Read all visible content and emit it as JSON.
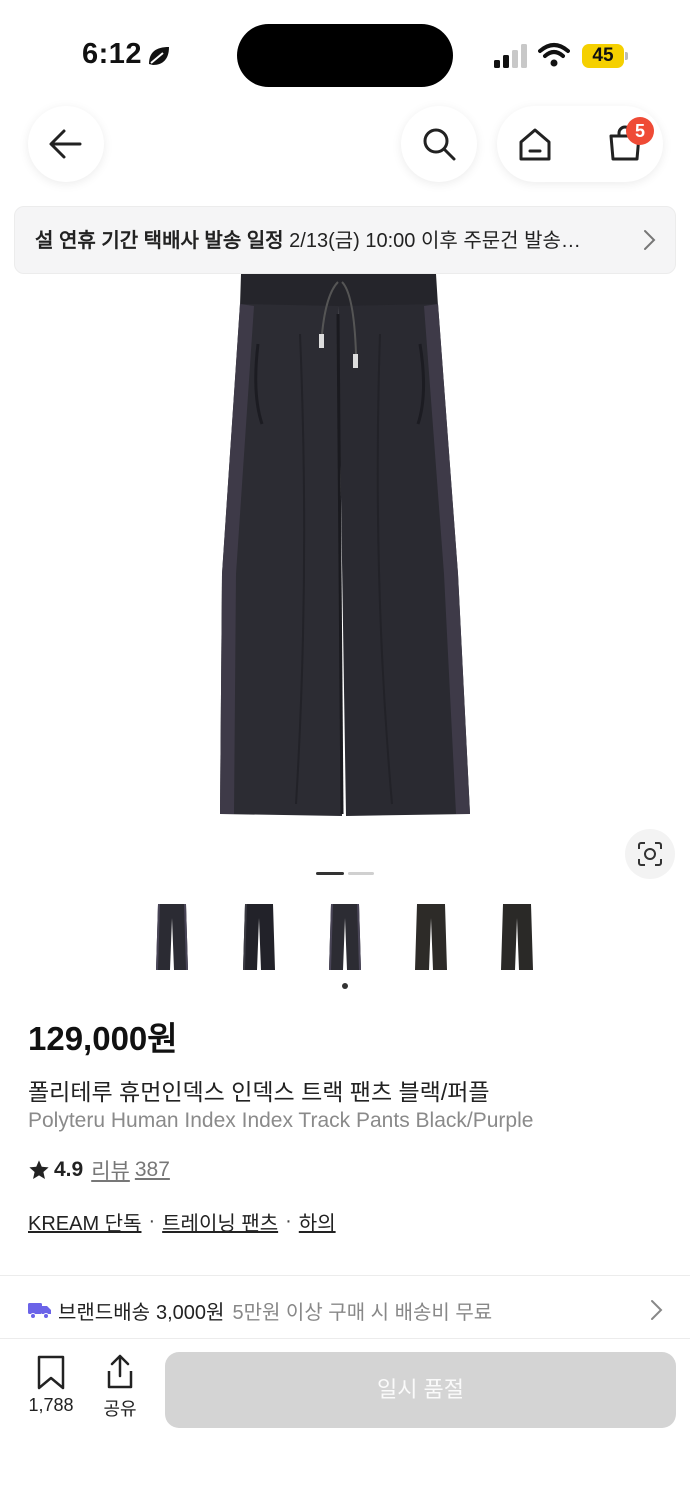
{
  "status_bar": {
    "time": "6:12",
    "battery": "45",
    "battery_color": "#f5d000"
  },
  "nav": {
    "back_icon": "arrow-left-icon",
    "search_icon": "search-icon",
    "home_icon": "home-icon",
    "cart_icon": "shopping-bag-icon",
    "cart_badge": "5",
    "badge_color": "#ef4b36"
  },
  "notice": {
    "bold_text": "설 연휴 기간 택배사 발송 일정",
    "text": "2/13(금) 10:00 이후 주문건 발송…"
  },
  "gallery": {
    "total_pages": 2,
    "current_page": 1,
    "thumbnail_count": 5,
    "selected_thumbnail": 3
  },
  "product": {
    "price": "129,000원",
    "name_ko": "폴리테루 휴먼인덱스 인덱스 트랙 팬츠 블랙/퍼플",
    "name_en": "Polyteru Human Index Index Track Pants Black/Purple",
    "rating": "4.9",
    "review_label": "리뷰",
    "review_count": "387",
    "breadcrumbs": [
      "KREAM 단독",
      "트레이닝 팬츠",
      "하의"
    ]
  },
  "shipping": {
    "label": "브랜드배송",
    "fee": "3,000원",
    "note": "5만원 이상 구매 시 배송비 무료",
    "truck_color": "#6b63e8"
  },
  "bottom_bar": {
    "bookmark_count": "1,788",
    "share_label": "공유",
    "cta_label": "일시 품절"
  }
}
